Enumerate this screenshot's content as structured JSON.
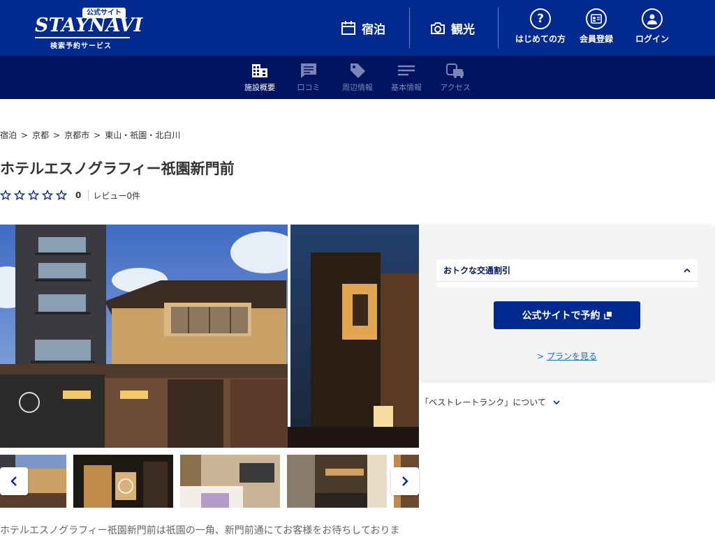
{
  "header": {
    "logo": {
      "badge": "公式サイト",
      "word": "STAYNAVI",
      "subtitle": "検索予約サービス"
    },
    "nav": [
      {
        "label": "宿泊",
        "icon": "calendar-icon"
      },
      {
        "label": "観光",
        "icon": "camera-icon"
      }
    ],
    "user": [
      {
        "label": "はじめての方",
        "icon": "question-icon"
      },
      {
        "label": "会員登録",
        "icon": "member-card-icon"
      },
      {
        "label": "ログイン",
        "icon": "person-icon"
      }
    ]
  },
  "subnav": {
    "tabs": [
      {
        "label": "施設概要",
        "icon": "building-icon",
        "active": true
      },
      {
        "label": "口コミ",
        "icon": "comment-icon",
        "active": false
      },
      {
        "label": "周辺情報",
        "icon": "tag-icon",
        "active": false
      },
      {
        "label": "基本情報",
        "icon": "list-icon",
        "active": false
      },
      {
        "label": "アクセス",
        "icon": "car-train-icon",
        "active": false
      }
    ]
  },
  "breadcrumb": [
    "宿泊",
    "京都",
    "京都市",
    "東山・祇園・北白川"
  ],
  "breadcrumb_sep": ">",
  "hotel": {
    "name": "ホテルエスノグラフィー祇園新門前",
    "rating": {
      "stars": 0,
      "max": 5,
      "value": "0",
      "reviews": "レビュー0件"
    },
    "description": "ホテルエスノグラフィー祇園新門前は祇園の一角、新門前通にてお客様をお待ちしておりま"
  },
  "booking": {
    "discount_label": "おトクな交通割引",
    "book_button": "公式サイトで予約",
    "plan_prefix": ">",
    "plan_link": "プランを見る",
    "rank_label": "「ベストレートランク」について"
  },
  "colors": {
    "header": "#002a8f",
    "subnav": "#001360",
    "button": "#002a8f",
    "link": "#1a6dc9",
    "star": "#001f7a"
  }
}
